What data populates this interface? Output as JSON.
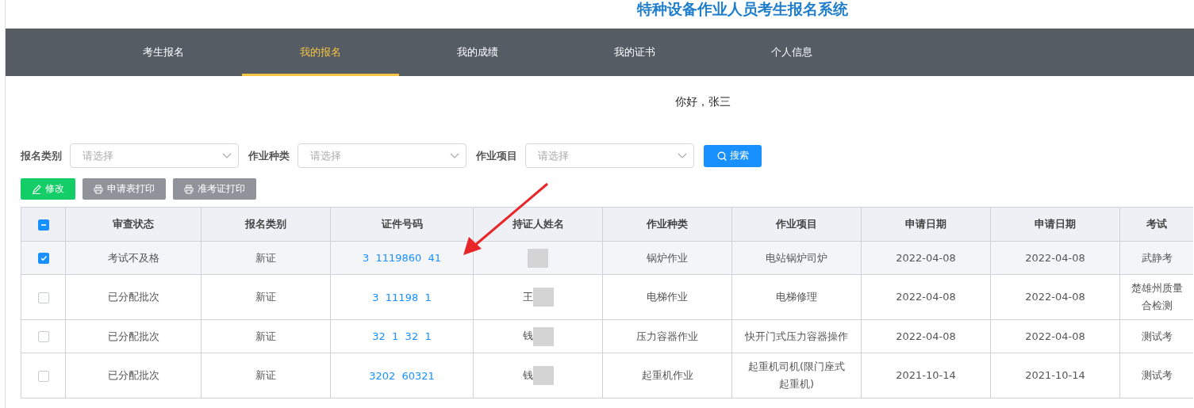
{
  "header": {
    "title": "特种设备作业人员考生报名系统"
  },
  "nav": [
    {
      "label": "考生报名",
      "selected": false
    },
    {
      "label": "我的报名",
      "selected": true
    },
    {
      "label": "我的成绩",
      "selected": false
    },
    {
      "label": "我的证书",
      "selected": false
    },
    {
      "label": "个人信息",
      "selected": false
    }
  ],
  "greeting": "你好，张三",
  "filters": [
    {
      "label": "报名类别",
      "placeholder": "请选择"
    },
    {
      "label": "作业种类",
      "placeholder": "请选择"
    },
    {
      "label": "作业项目",
      "placeholder": "请选择"
    }
  ],
  "search_button": "搜索",
  "actions": [
    {
      "label": "修改",
      "kind": "edit"
    },
    {
      "label": "申请表打印",
      "kind": "print"
    },
    {
      "label": "准考证打印",
      "kind": "print"
    }
  ],
  "table": {
    "select_all": {
      "indeterminate": true
    },
    "columns": [
      "审查状态",
      "报名类别",
      "证件号码",
      "持证人姓名",
      "作业种类",
      "作业项目",
      "申请日期",
      "申请日期",
      "考试"
    ],
    "rows": [
      {
        "selected": true,
        "cells": [
          "考试不及格",
          "新证",
          "3  1119860  41",
          "",
          "锅炉作业",
          "电站锅炉司炉",
          "2022-04-08",
          "2022-04-08",
          "武静考"
        ]
      },
      {
        "selected": false,
        "cells": [
          "已分配批次",
          "新证",
          "3  11198  1",
          "王",
          "电梯作业",
          "电梯修理",
          "2022-04-08",
          "2022-04-08",
          "楚雄州质量合检测"
        ]
      },
      {
        "selected": false,
        "cells": [
          "已分配批次",
          "新证",
          "32  1  32  1",
          "钱",
          "压力容器作业",
          "快开门式压力容器操作",
          "2022-04-08",
          "2022-04-08",
          "测试考"
        ]
      },
      {
        "selected": false,
        "cells": [
          "已分配批次",
          "新证",
          "3202  60321",
          "钱",
          "起重机作业",
          "起重机司机(限门座式起重机)",
          "2021-10-14",
          "2021-10-14",
          "测试考"
        ]
      }
    ]
  },
  "annotation": {
    "kind": "arrow"
  }
}
